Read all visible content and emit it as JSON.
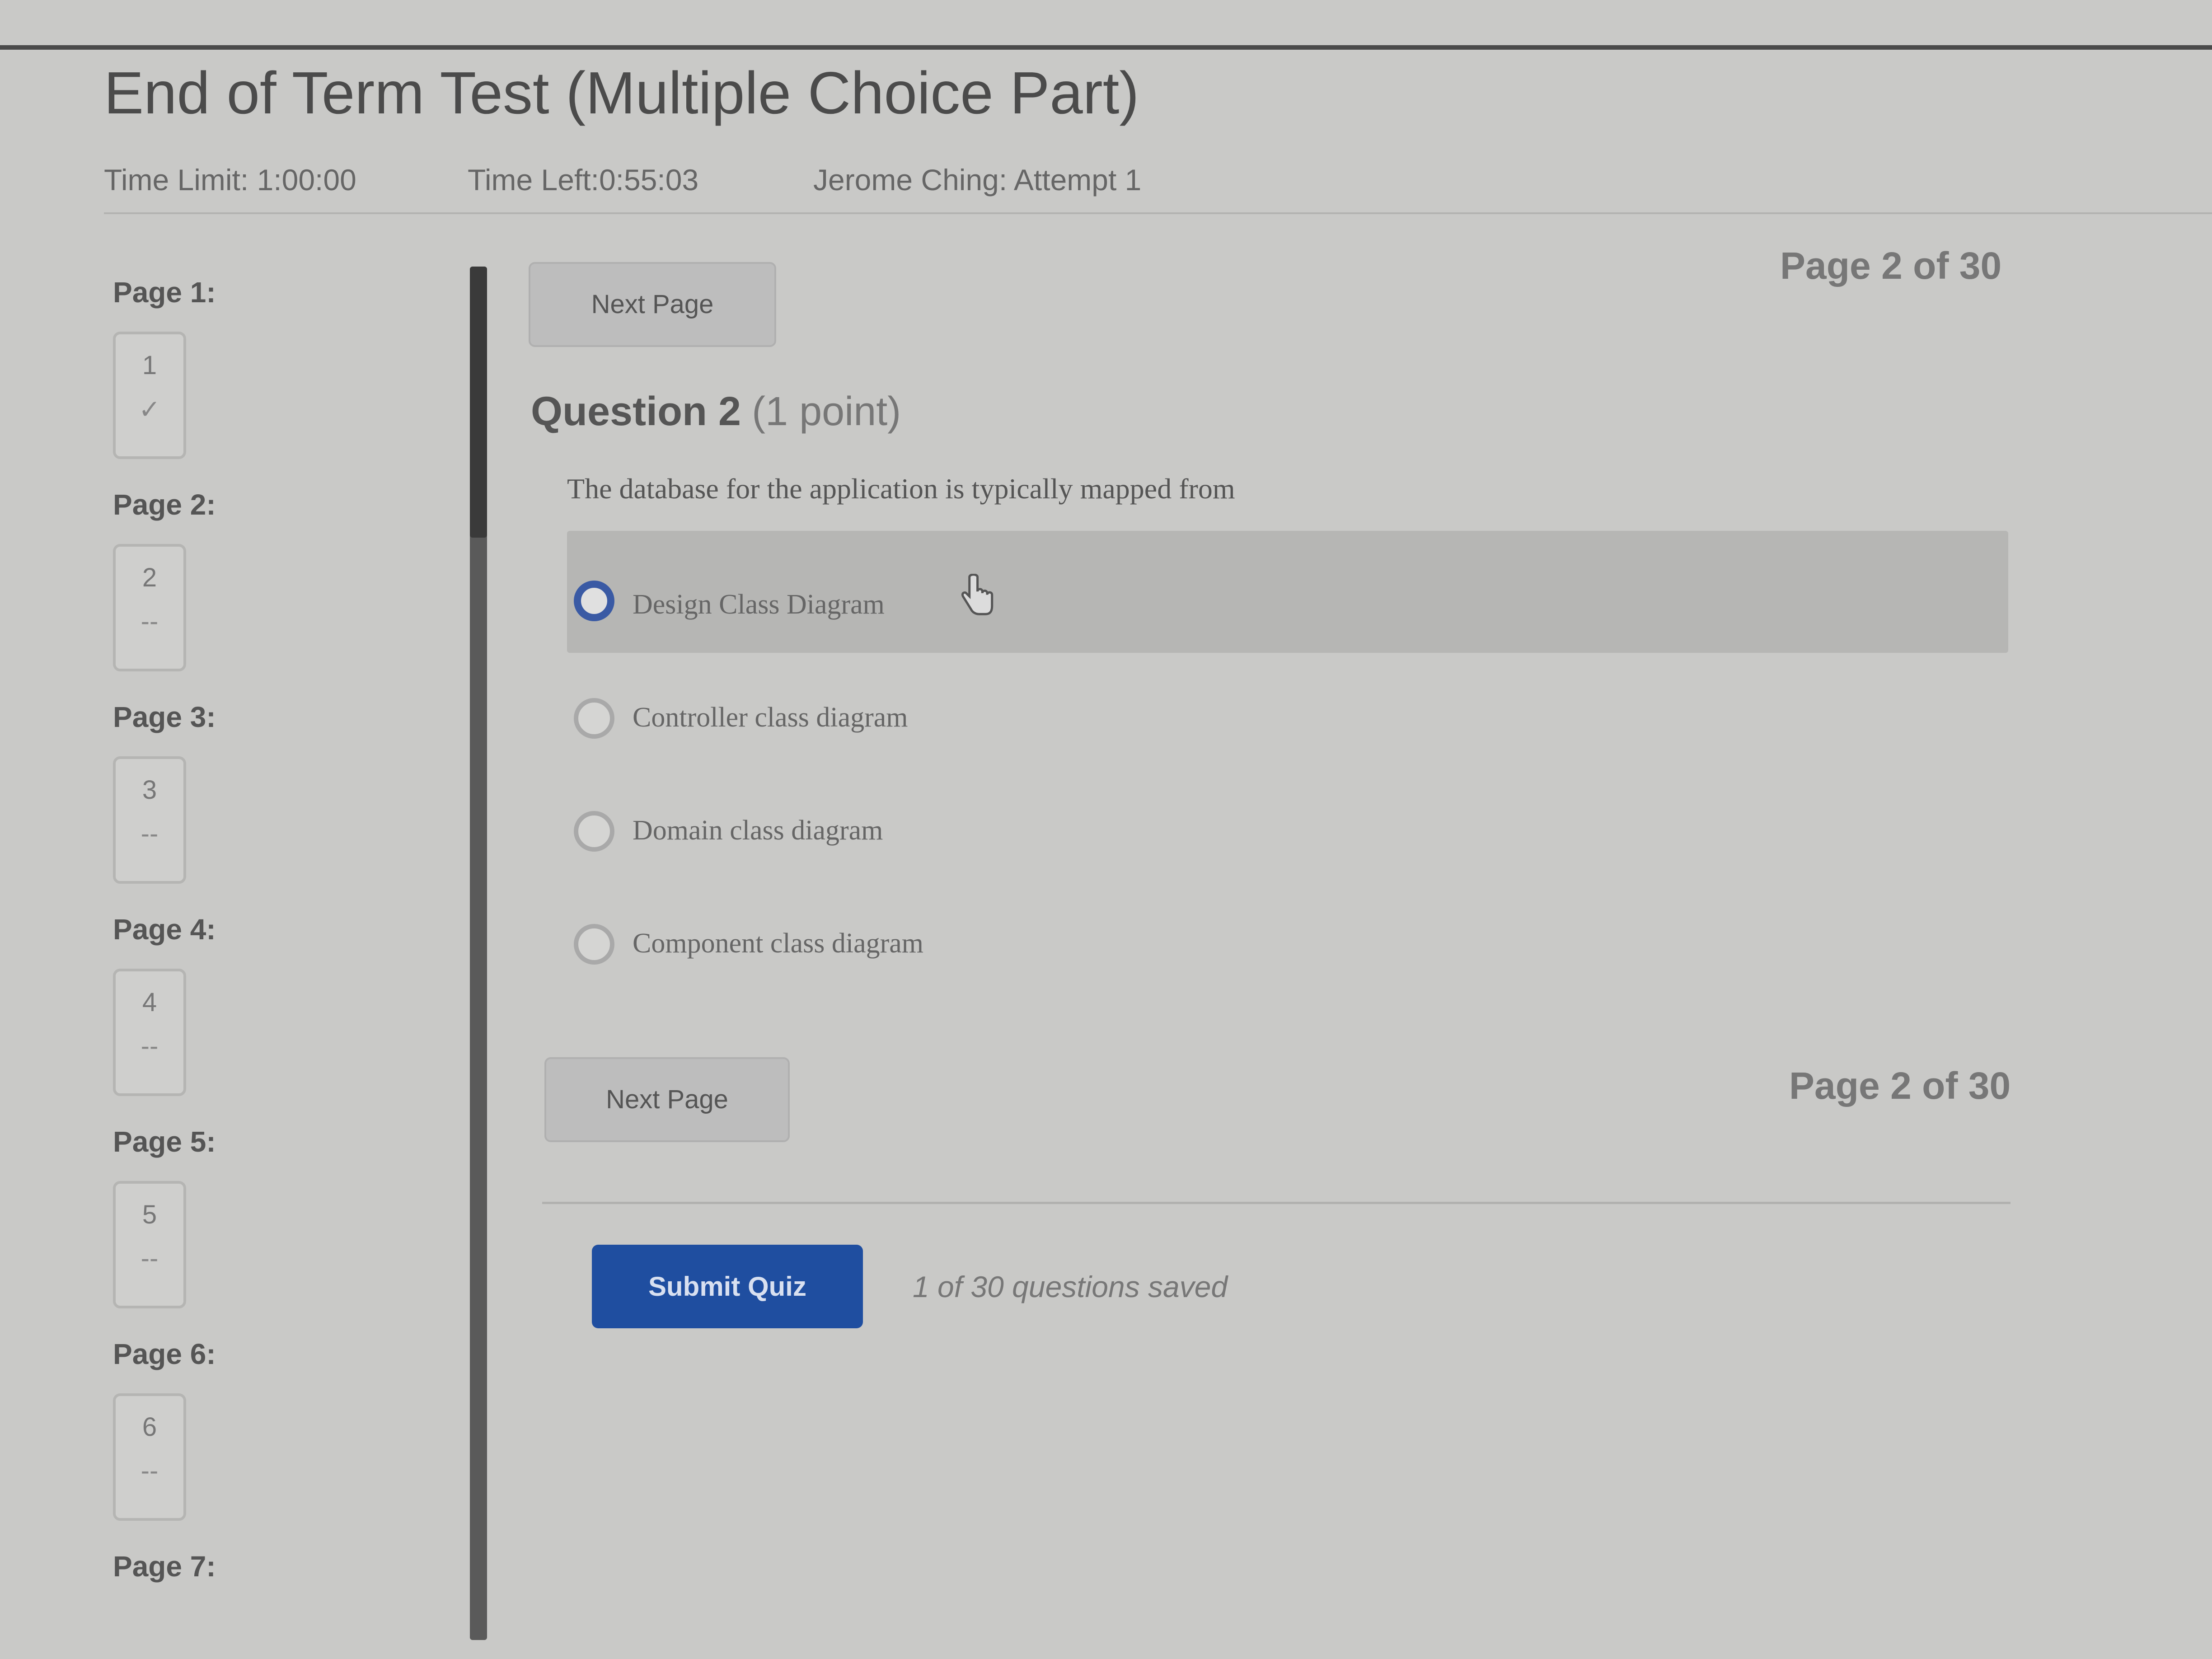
{
  "quiz": {
    "title": "End of Term Test (Multiple Choice Part)",
    "time_limit": "Time Limit: 1:00:00",
    "time_left": "Time Left:0:55:03",
    "attempt": "Jerome Ching: Attempt 1"
  },
  "sidebar": {
    "pages": [
      {
        "label": "Page 1:",
        "number": "1",
        "status": "✓"
      },
      {
        "label": "Page 2:",
        "number": "2",
        "status": "--"
      },
      {
        "label": "Page 3:",
        "number": "3",
        "status": "--"
      },
      {
        "label": "Page 4:",
        "number": "4",
        "status": "--"
      },
      {
        "label": "Page 5:",
        "number": "5",
        "status": "--"
      },
      {
        "label": "Page 6:",
        "number": "6",
        "status": "--"
      },
      {
        "label": "Page 7:",
        "number": "",
        "status": ""
      }
    ]
  },
  "navigation": {
    "next_page_label": "Next Page",
    "page_indicator": "Page 2 of 30"
  },
  "question": {
    "number_label": "Question 2",
    "points_label": "(1 point)",
    "text": "The database for the application is typically mapped from",
    "options": [
      {
        "label": "Design Class Diagram",
        "selected": true
      },
      {
        "label": "Controller class diagram",
        "selected": false
      },
      {
        "label": "Domain class diagram",
        "selected": false
      },
      {
        "label": "Component class diagram",
        "selected": false
      }
    ]
  },
  "footer": {
    "submit_label": "Submit Quiz",
    "saved_status": "1 of 30 questions saved"
  },
  "colors": {
    "background": "#c9c9c7",
    "submit_button": "#1f4ea0",
    "selected_radio": "#3a5aa4"
  },
  "icons": {
    "cursor": "hand-pointer-icon",
    "page_complete": "checkmark-icon"
  }
}
